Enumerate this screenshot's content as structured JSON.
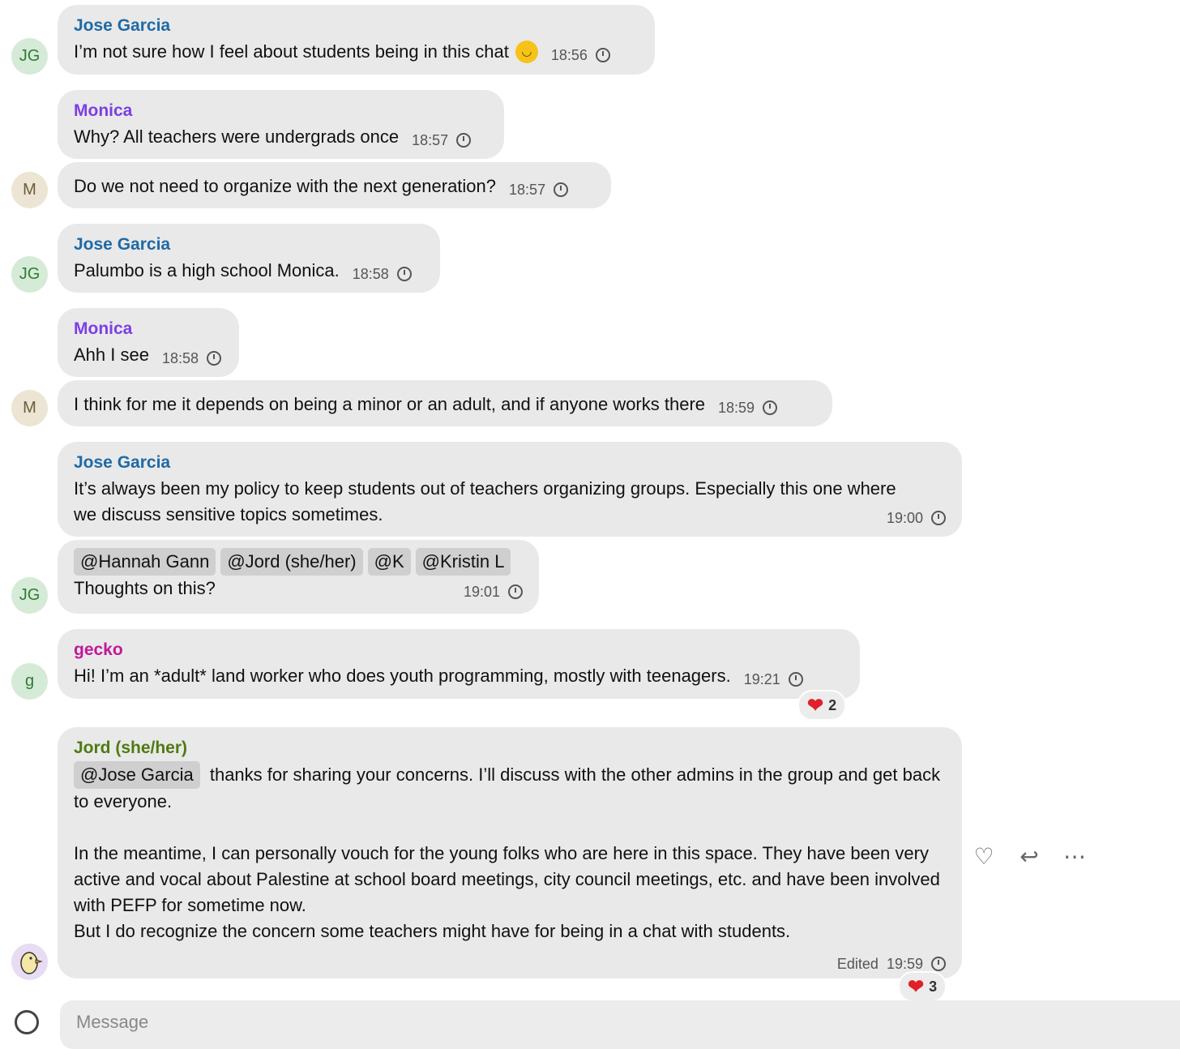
{
  "messages": [
    {
      "sender": "Jose Garcia",
      "text": "I’m not sure how I feel about students being in this chat",
      "time": "18:56"
    },
    {
      "sender": "Monica",
      "text": "Why? All teachers were undergrads once",
      "time": "18:57"
    },
    {
      "text": "Do we not need to organize with the next generation?",
      "time": "18:57"
    },
    {
      "sender": "Jose Garcia",
      "text": "Palumbo is a high school Monica.",
      "time": "18:58"
    },
    {
      "sender": "Monica",
      "text": "Ahh I see",
      "time": "18:58"
    },
    {
      "text": "I think for me it depends on being a minor or an adult, and if anyone works there",
      "time": "18:59"
    },
    {
      "sender": "Jose Garcia",
      "text": "It’s always been my policy to keep students out of teachers organizing groups. Especially this one where we discuss sensitive topics sometimes.",
      "time": "19:00"
    },
    {
      "mentions": [
        "@Hannah Gann",
        "@Jord (she/her)",
        "@K",
        "@Kristin L"
      ],
      "text": "Thoughts on this?",
      "time": "19:01"
    },
    {
      "sender": "gecko",
      "text": "Hi! I’m an *adult* land worker who does youth programming, mostly with teenagers.",
      "time": "19:21",
      "reaction_count": "2"
    },
    {
      "sender": "Jord (she/her)",
      "mention": "@Jose Garcia",
      "text1": "thanks for sharing your concerns. I’ll discuss with the other admins in the group and get back to everyone.",
      "text2": "In the meantime, I can personally vouch for the young folks who are here in this space. They have been very active and vocal about Palestine at school board meetings, city council meetings, etc. and have been involved with PEFP for sometime now.",
      "text3": "But I do recognize the concern some teachers might have for being in a chat with students.",
      "edited": "Edited",
      "time": "19:59",
      "reaction_count": "3"
    }
  ],
  "avatars": {
    "jg": "JG",
    "m": "M",
    "g": "g"
  },
  "composer": {
    "placeholder": "Message"
  }
}
